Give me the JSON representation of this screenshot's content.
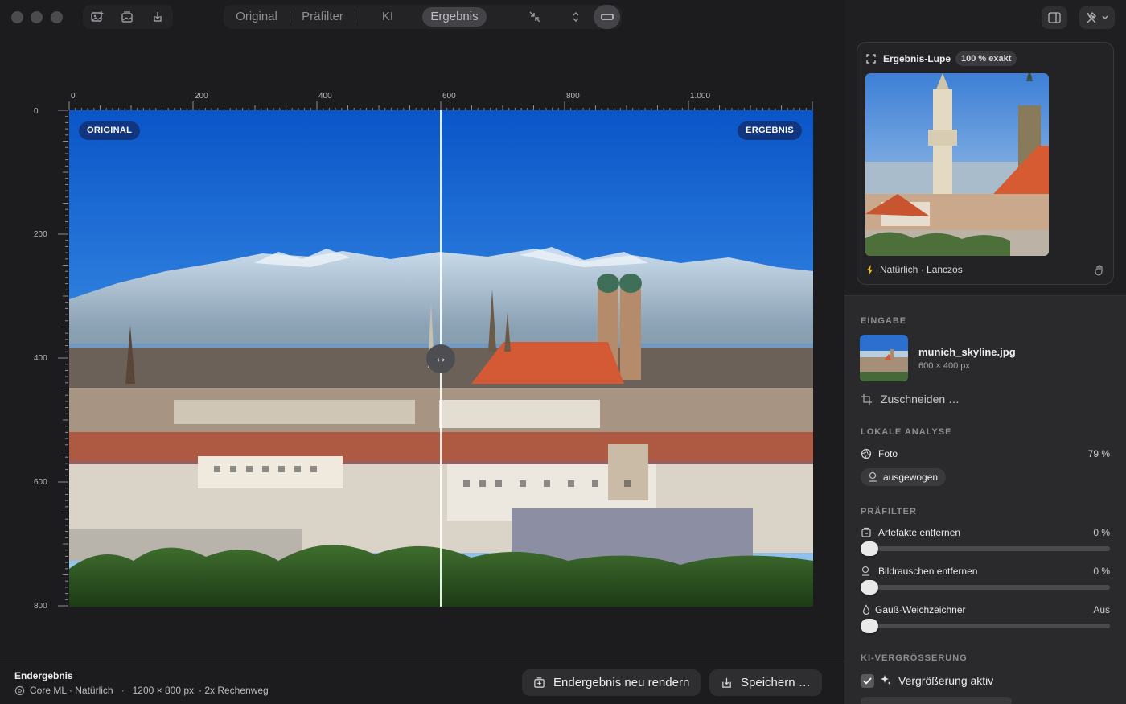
{
  "toolbar": {
    "tabs": [
      {
        "label": "Original",
        "active": false
      },
      {
        "label": "Präfilter",
        "active": false
      },
      {
        "label": "KI",
        "active": false
      },
      {
        "label": "Ergebnis",
        "active": true
      }
    ]
  },
  "canvas": {
    "ruler_x": [
      "0",
      "200",
      "400",
      "600",
      "800",
      "1.000"
    ],
    "ruler_y": [
      "0",
      "200",
      "400",
      "600",
      "800"
    ],
    "badge_original": "ORIGINAL",
    "badge_result": "ERGEBNIS",
    "split_handle_glyph": "↔"
  },
  "status": {
    "title": "Endergebnis",
    "engine": "Core ML · Natürlich",
    "size": "1200 × 800 px",
    "mode": "· 2x Rechenweg",
    "rerender_label": "Endergebnis neu rendern",
    "save_label": "Speichern …"
  },
  "panel": {
    "loupe": {
      "title": "Ergebnis-Lupe",
      "badge": "100 % exakt",
      "footer": "Natürlich · Lanczos"
    },
    "input": {
      "heading": "EINGABE",
      "filename": "munich_skyline.jpg",
      "dimensions": "600 × 400 px",
      "crop_label": "Zuschneiden …"
    },
    "analysis": {
      "heading": "LOKALE ANALYSE",
      "type_label": "Foto",
      "type_value": "79 %",
      "chip": "ausgewogen"
    },
    "prefilter": {
      "heading": "PRÄFILTER",
      "items": [
        {
          "label": "Artefakte entfernen",
          "value": "0 %",
          "level": 0
        },
        {
          "label": "Bildrauschen entfernen",
          "value": "0 %",
          "level": 0
        },
        {
          "label": "Gauß-Weichzeichner",
          "value": "Aus",
          "level": 0
        }
      ]
    },
    "upscale": {
      "heading": "KI-VERGRÖSSERUNG",
      "enabled_label": "Vergrößerung aktiv",
      "enabled": true
    }
  },
  "colors": {
    "window_bg": "#1c1c1e",
    "panel_bg": "#2a2a2d",
    "badge_bg": "#142d6e",
    "sky_top": "#0a55c8"
  }
}
